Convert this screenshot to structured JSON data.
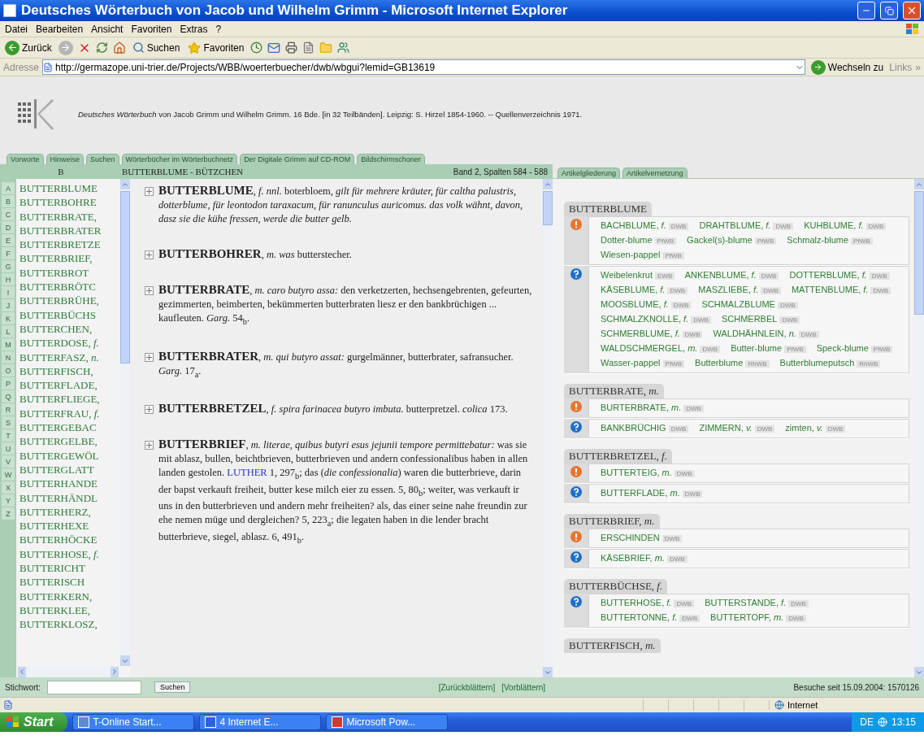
{
  "window": {
    "title": "Deutsches Wörterbuch von Jacob und Wilhelm Grimm - Microsoft Internet Explorer"
  },
  "menu": [
    "Datei",
    "Bearbeiten",
    "Ansicht",
    "Favoriten",
    "Extras",
    "?"
  ],
  "toolbar": {
    "back": "Zurück",
    "search": "Suchen",
    "favorites": "Favoriten"
  },
  "address": {
    "label": "Adresse",
    "value": "http://germazope.uni-trier.de/Projects/WBB/woerterbuecher/dwb/wbgui?lemid=GB13619",
    "go": "Wechseln zu",
    "links": "Links",
    "more": "»"
  },
  "citation": "*Deutsches Wörterbuch* von Jacob Grimm und Wilhelm Grimm. 16 Bde. [in 32 Teilbänden]. Leipzig: S. Hirzel 1854-1960. -- Quellenverzeichnis 1971.",
  "nav_tabs": [
    "Vorworte",
    "Hinweise",
    "Suchen",
    "Wörterbücher im Wörterbuchnetz",
    "Der Digitale Grimm auf CD-ROM",
    "Bildschirmschoner"
  ],
  "header": {
    "letter": "B",
    "range": "BUTTERBLUME - BÜTZCHEN",
    "volume": "Band 2, Spalten 584 - 588"
  },
  "article_tabs": [
    "Artikelgliederung",
    "Artikelvernetzung"
  ],
  "letters": [
    "A",
    "B",
    "C",
    "D",
    "E",
    "F",
    "G",
    "H",
    "I",
    "J",
    "K",
    "L",
    "M",
    "N",
    "O",
    "P",
    "Q",
    "R",
    "S",
    "T",
    "U",
    "V",
    "W",
    "X",
    "Y",
    "Z"
  ],
  "lemmas": [
    "BUTTERBLUME",
    "BUTTERBOHRE",
    "BUTTERBRATE,",
    "BUTTERBRATER",
    "BUTTERBRETZE",
    "BUTTERBRIEF,",
    "BUTTERBROT",
    "BUTTERBRÖTC",
    "BUTTERBRÜHE,",
    "BUTTERBÜCHS",
    "BUTTERCHEN,",
    "BUTTERDOSE, *f.*",
    "BUTTERFASZ, *n.*",
    "BUTTERFISCH,",
    "BUTTERFLADE,",
    "BUTTERFLIEGE,",
    "BUTTERFRAU, *f.*",
    "BUTTERGEBAC",
    "BUTTERGELBE,",
    "BUTTERGEWÖL",
    "BUTTERGLATT",
    "BUTTERHANDE",
    "BUTTERHÄNDL",
    "BUTTERHERZ,",
    "BUTTERHEXE",
    "BUTTERHÖCKE",
    "BUTTERHOSE, *f.*",
    "BUTTERICHT",
    "BUTTERISCH",
    "BUTTERKERN,",
    "BUTTERKLEE,",
    "BUTTERKLOSZ,"
  ],
  "articles": [
    {
      "head": "BUTTERBLUME",
      "text": ", *f. nnl.* boterbloem, *gilt für mehrere kräuter, für caltha palustris, dotterblume, für leontodon taraxacum, für ranunculus auricomus. das volk wähnt, davon, dasz sie die kühe fressen, werde die butter gelb.*"
    },
    {
      "head": "BUTTERBOHRER",
      "text": ", *m. was* butterstecher."
    },
    {
      "head": "BUTTERBRATE",
      "text": ", *m. caro butyro assa:* den verketzerten, hechsengebrenten, gefeurten, gezimmerten, beimberten, bekümmerten butterbraten liesz er den bankbrüchigen ... kaufleuten. *Garg.* 54$_{b}$."
    },
    {
      "head": "BUTTERBRATER",
      "text": ", *m. qui butyro assat:* gurgelmänner, butterbrater, safransucher. *Garg.* 17$_{a}$."
    },
    {
      "head": "BUTTERBRETZEL",
      "text": ", *f. spira farinacea butyro imbuta.* butterpretzel. *colica* 173."
    },
    {
      "head": "BUTTERBRIEF",
      "text": ", *m. literae, quibus butyri esus jejunii tempore permittebatur:* was sie mit ablasz, bullen, beichtbrieven, butterbrieven und andern confessionalibus haben in allen landen gestolen.",
      "link": "LUTHER",
      "after": " 1, 297$_{b}$; das (*die confessionalia*) waren die butterbrieve, darin der bapst verkauft freiheit, butter kese milch eier zu essen. 5, 80$_{b}$; weiter, was verkauft ir uns in den butterbrieven und andern mehr freiheiten? als, das einer seine nahe freundin zur ehe nemen müge und dergleichen? 5, 223$_{a}$; die legaten haben in die lender bracht butterbrieve, siegel, ablasz. 6, 491$_{b}$."
    }
  ],
  "links_panel": [
    {
      "title": "BUTTERBLUME",
      "rows": [
        {
          "kind": "warning",
          "items": [
            {
              "word": "BACHBLUME, *f.*",
              "source": "DWB"
            },
            {
              "word": "DRAHTBLUME, *f.*",
              "source": "DWB"
            },
            {
              "word": "KUHBLUME, *f.*",
              "source": "DWB"
            },
            {
              "word": "Dotter-blume",
              "source": "PfWB"
            },
            {
              "word": "Gackel(s)-blume",
              "source": "PfWB"
            },
            {
              "word": "Schmalz-blume",
              "source": "PfWB"
            },
            {
              "word": "Wiesen-pappel",
              "source": "PfWB"
            }
          ]
        },
        {
          "kind": "question",
          "items": [
            {
              "word": "Weibelenkrut",
              "source": "EWB"
            },
            {
              "word": "ANKENBLUME, *f.*",
              "source": "DWB"
            },
            {
              "word": "DOTTERBLUME, *f.*",
              "source": "DWB"
            },
            {
              "word": "KÄSEBLUME, *f.*",
              "source": "DWB"
            },
            {
              "word": "MASZLIEBE, *f.*",
              "source": "DWB"
            },
            {
              "word": "MATTENBLUME, *f.*",
              "source": "DWB"
            },
            {
              "word": "MOOSBLUME, *f.*",
              "source": "DWB"
            },
            {
              "word": "SCHMALZBLUME",
              "source": "DWB"
            },
            {
              "word": "SCHMALZKNOLLE, *f.*",
              "source": "DWB"
            },
            {
              "word": "SCHMERBEL",
              "source": "DWB"
            },
            {
              "word": "SCHMERBLUME, *f.*",
              "source": "DWB"
            },
            {
              "word": "WALDHÄHNLEIN, *n.*",
              "source": "DWB"
            },
            {
              "word": "WALDSCHMERGEL, *m.*",
              "source": "DWB"
            },
            {
              "word": "Butter-blume",
              "source": "PfWB"
            },
            {
              "word": "Speck-blume",
              "source": "PfWB"
            },
            {
              "word": "Wasser-pappel",
              "source": "PfWB"
            },
            {
              "word": "Butterblume",
              "source": "RhWB"
            },
            {
              "word": "Butterblumeputsch",
              "source": "RhWB"
            }
          ]
        }
      ]
    },
    {
      "title": "BUTTERBRATE, *m.*",
      "rows": [
        {
          "kind": "warning",
          "items": [
            {
              "word": "BURTERBRATE, *m.*",
              "source": "DWB"
            }
          ]
        },
        {
          "kind": "question",
          "items": [
            {
              "word": "BANKBRÜCHIG",
              "source": "DWB"
            },
            {
              "word": "ZIMMERN, *v.*",
              "source": "DWB"
            },
            {
              "word": "zimten, *v.*",
              "source": "DWB"
            }
          ]
        }
      ]
    },
    {
      "title": "BUTTERBRETZEL, *f.*",
      "rows": [
        {
          "kind": "warning",
          "items": [
            {
              "word": "BUTTERTEIG, *m.*",
              "source": "DWB"
            }
          ]
        },
        {
          "kind": "question",
          "items": [
            {
              "word": "BUTTERFLADE, *m.*",
              "source": "DWB"
            }
          ]
        }
      ]
    },
    {
      "title": "BUTTERBRIEF, *m.*",
      "rows": [
        {
          "kind": "warning",
          "items": [
            {
              "word": "ERSCHINDEN",
              "source": "DWB"
            }
          ]
        },
        {
          "kind": "question",
          "items": [
            {
              "word": "KÄSEBRIEF, *m.*",
              "source": "DWB"
            }
          ]
        }
      ]
    },
    {
      "title": "BUTTERBÜCHSE, *f.*",
      "rows": [
        {
          "kind": "question",
          "items": [
            {
              "word": "BUTTERHOSE, *f.*",
              "source": "DWB"
            },
            {
              "word": "BUTTERSTANDE, *f.*",
              "source": "DWB"
            },
            {
              "word": "BUTTERTONNE, *f.*",
              "source": "DWB"
            },
            {
              "word": "BUTTERTOPF, *m.*",
              "source": "DWB"
            }
          ]
        }
      ]
    },
    {
      "title": "BUTTERFISCH, *m.*"
    }
  ],
  "footer": {
    "label": "Stichwort:",
    "button": "Suchen",
    "prev": "[Zurückblättern]",
    "next": "[Vorblättern]",
    "visits": "Besuche seit 15.09.2004: 1570126"
  },
  "status_bar": {
    "zone": "Internet"
  },
  "taskbar": {
    "start": "Start",
    "tasks": [
      "T-Online Start...",
      "4 Internet E...",
      "Microsoft Pow..."
    ],
    "language": "DE",
    "clock": "13:15"
  }
}
